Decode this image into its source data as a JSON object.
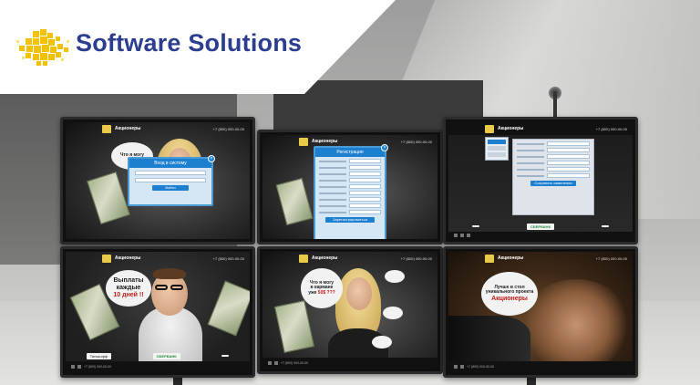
{
  "brand": {
    "name": "Software Solutions",
    "color": "#2c3e8f",
    "mark_color": "#f2c200"
  },
  "site": {
    "name": "Акционеры",
    "phone": "+7 (800) 000-00-00"
  },
  "screens": {
    "top_left": {
      "modal_title": "Вход в систему",
      "button": "Войти",
      "bubble": "Что я могу"
    },
    "top_middle": {
      "modal_title": "Регистрация",
      "button": "Зарегистрироваться"
    },
    "top_right": {
      "button": "Сохранить изменения"
    },
    "bottom_left": {
      "bubble_line1": "Выплаты",
      "bubble_line2": "каждые",
      "bubble_accent": "10 дней !!",
      "partner_green": "СБЕРБАНК",
      "partner_blue": "",
      "partner_other": "Тинькофф"
    },
    "bottom_middle": {
      "bubble_line1": "Что я могу",
      "bubble_line2": "в кармане",
      "bubble_line3": "уже",
      "bubble_accent": "50$ ???",
      "side_bubbles": [
        "",
        "",
        ""
      ]
    },
    "bottom_right": {
      "bubble_line1": "Лучше в стол",
      "bubble_line2": "уникального проекта",
      "bubble_accent": "Акционеры"
    }
  },
  "icons": [
    "cube-cluster-logo-icon",
    "close-icon"
  ]
}
